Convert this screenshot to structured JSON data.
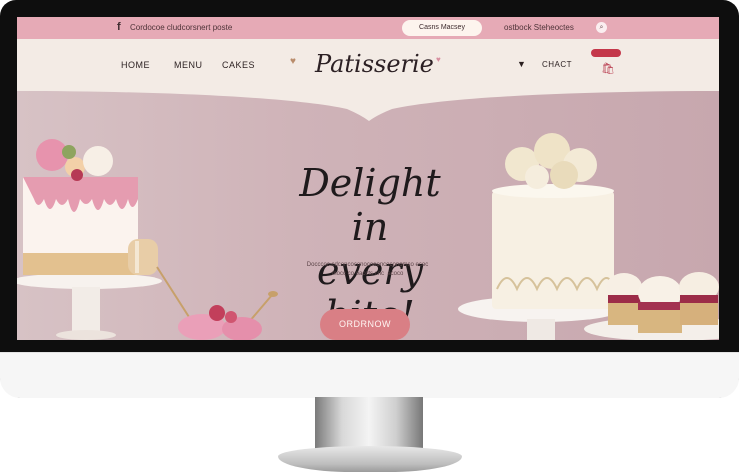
{
  "topbar": {
    "social_icon": "f",
    "info_text": "Cordocoe cludcorsnert poste",
    "pill_label": "Casns Macsey",
    "contact_text": "ostbock Steheoctes",
    "search_icon": "search-icon"
  },
  "nav": {
    "home": "HOME",
    "menu": "MENU",
    "cakes": "CAKES",
    "brand": "Patisserie",
    "contact": "CHACT",
    "icons": [
      "heart-icon",
      "flag-icon",
      "cart-icon"
    ]
  },
  "hero": {
    "title": "Delight in\nevery bite!",
    "description": "Docccoc cdconcoconocoeoncoconomco ecoc\nmocc co oaccts cnc  acoco",
    "cta": "ORDRNOW"
  },
  "colors": {
    "topbar": "#e6aab6",
    "navbar": "#f3ebe5",
    "hero": "#cfb3b8",
    "cta": "#d97f85",
    "brand_text": "#2c2024"
  }
}
